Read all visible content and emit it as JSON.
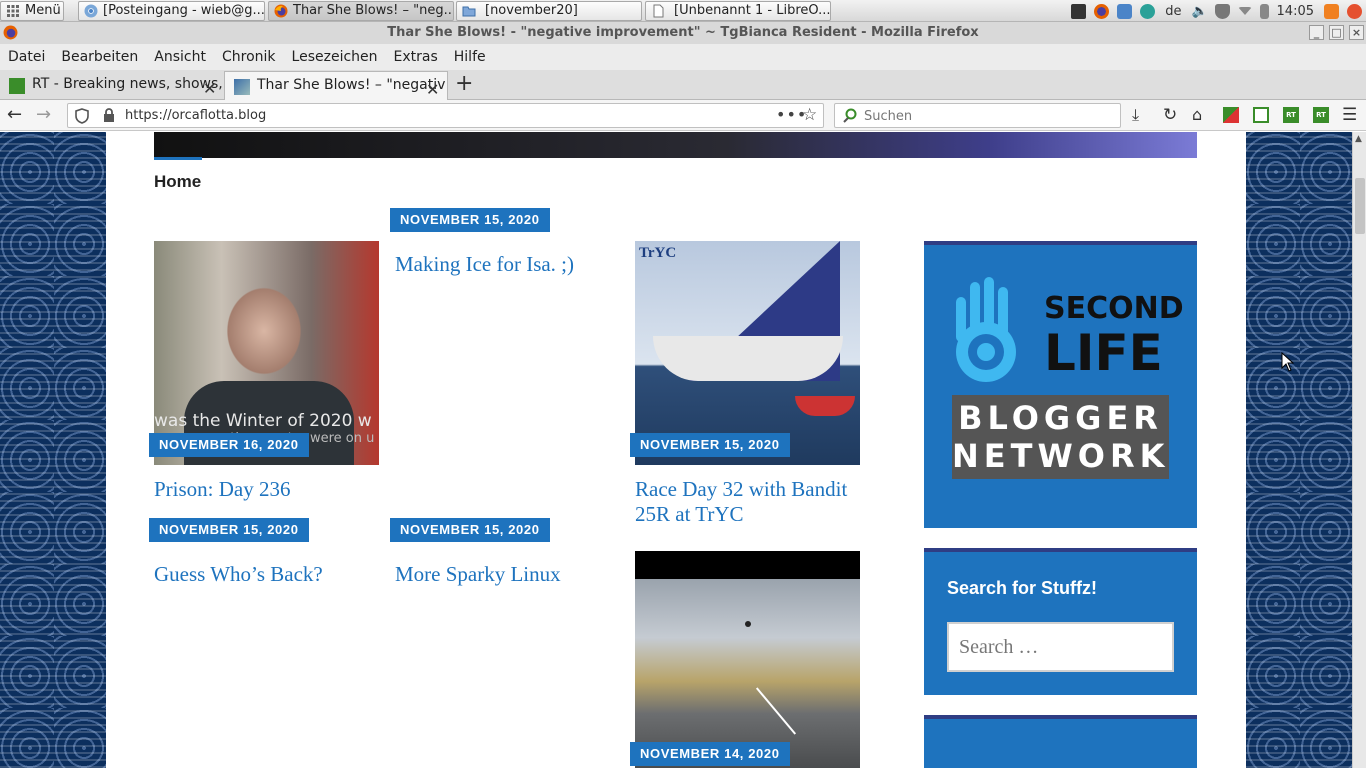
{
  "taskbar": {
    "menu_label": "Menü",
    "windows": [
      {
        "label": "[Posteingang - wieb@g...",
        "icon": "chromium-icon"
      },
      {
        "label": "Thar She Blows! – \"neg...",
        "icon": "firefox-icon"
      },
      {
        "label": "[november20]",
        "icon": "folder-icon"
      },
      {
        "label": "[Unbenannt 1 - LibreO...",
        "icon": "document-icon"
      }
    ],
    "language": "de",
    "clock": "14:05"
  },
  "window": {
    "title": "Thar She Blows! - \"negative improvement\" ~ TgBianca Resident - Mozilla Firefox"
  },
  "menubar": [
    "Datei",
    "Bearbeiten",
    "Ansicht",
    "Chronik",
    "Lesezeichen",
    "Extras",
    "Hilfe"
  ],
  "tabs": [
    {
      "label": "RT - Breaking news, shows,",
      "selected": false
    },
    {
      "label": "Thar She Blows! – \"negativ",
      "selected": true
    }
  ],
  "navbar": {
    "url": "https://orcaflotta.blog",
    "search_placeholder": "Suchen"
  },
  "blog": {
    "nav_home": "Home",
    "posts": [
      {
        "date": "NOVEMBER 15, 2020",
        "title": "Making Ice for Isa. ;)"
      },
      {
        "date": "NOVEMBER 16, 2020",
        "title": "Prison: Day 236",
        "thumb_caption": "was the Winter of 2020 w",
        "thumb_caption2": "entire country were on u"
      },
      {
        "date": "NOVEMBER 15, 2020",
        "title_line1": "Race Day 32 with Bandit",
        "title_line2": "25R at TrYC",
        "thumb_text": "TrYC"
      },
      {
        "date": "NOVEMBER 15, 2020",
        "title": "Guess Who’s Back?"
      },
      {
        "date": "NOVEMBER 15, 2020",
        "title": "More Sparky Linux"
      },
      {
        "date": "NOVEMBER 14, 2020"
      }
    ],
    "sidebar": {
      "logo_line1": "SECOND",
      "logo_line2": "LIFE",
      "logo_line3": "BLOGGER",
      "logo_line4": "NETWORK",
      "search_title": "Search for Stuffz!",
      "search_placeholder": "Search …"
    }
  },
  "colors": {
    "accent": "#1e73be",
    "widget_border": "#2f3d84",
    "background_pattern": "#0c2f5e"
  }
}
